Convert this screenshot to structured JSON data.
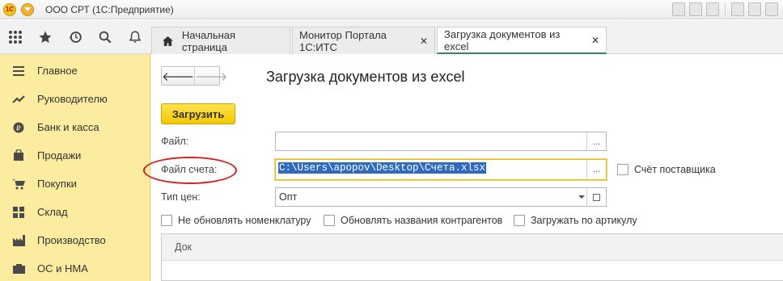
{
  "window": {
    "title": "ООО СРТ  (1С:Предприятие)",
    "logo_text": "1С"
  },
  "tabs": [
    {
      "label": "Начальная страница"
    },
    {
      "label": "Монитор Портала 1С:ИТС"
    },
    {
      "label": "Загрузка документов из excel"
    }
  ],
  "sidebar": {
    "items": [
      {
        "label": "Главное",
        "icon": "menu-lines-icon"
      },
      {
        "label": "Руководителю",
        "icon": "trend-chart-icon"
      },
      {
        "label": "Банк и касса",
        "icon": "ruble-coin-icon"
      },
      {
        "label": "Продажи",
        "icon": "shopping-bag-icon"
      },
      {
        "label": "Покупки",
        "icon": "shopping-cart-icon"
      },
      {
        "label": "Склад",
        "icon": "warehouse-grid-icon"
      },
      {
        "label": "Производство",
        "icon": "factory-icon"
      },
      {
        "label": "ОС и НМА",
        "icon": "assets-icon"
      }
    ]
  },
  "form": {
    "title": "Загрузка документов из excel",
    "load_button": "Загрузить",
    "file_label": "Файл:",
    "file_value": "",
    "invoice_file_label": "Файл счета:",
    "invoice_file_value": "C:\\Users\\apopov\\Desktop\\Счета.xlsx",
    "supplier_invoice_label": "Счёт поставщика",
    "price_type_label": "Тип цен:",
    "price_type_value": "Опт",
    "dots": "...",
    "checkbox_no_update_nomenclature": "Не обновлять номенклатуру",
    "checkbox_update_counterparty_names": "Обновлять названия контрагентов",
    "checkbox_load_by_article": "Загружать по артикулу",
    "table_column_doc": "Док"
  },
  "colors": {
    "sidebar_bg": "#fbec9f",
    "button_yellow": "#f3c800",
    "active_tab_underline": "#2c8b57",
    "annotation_red": "#d42020",
    "selection_blue": "#2f6ac1"
  }
}
